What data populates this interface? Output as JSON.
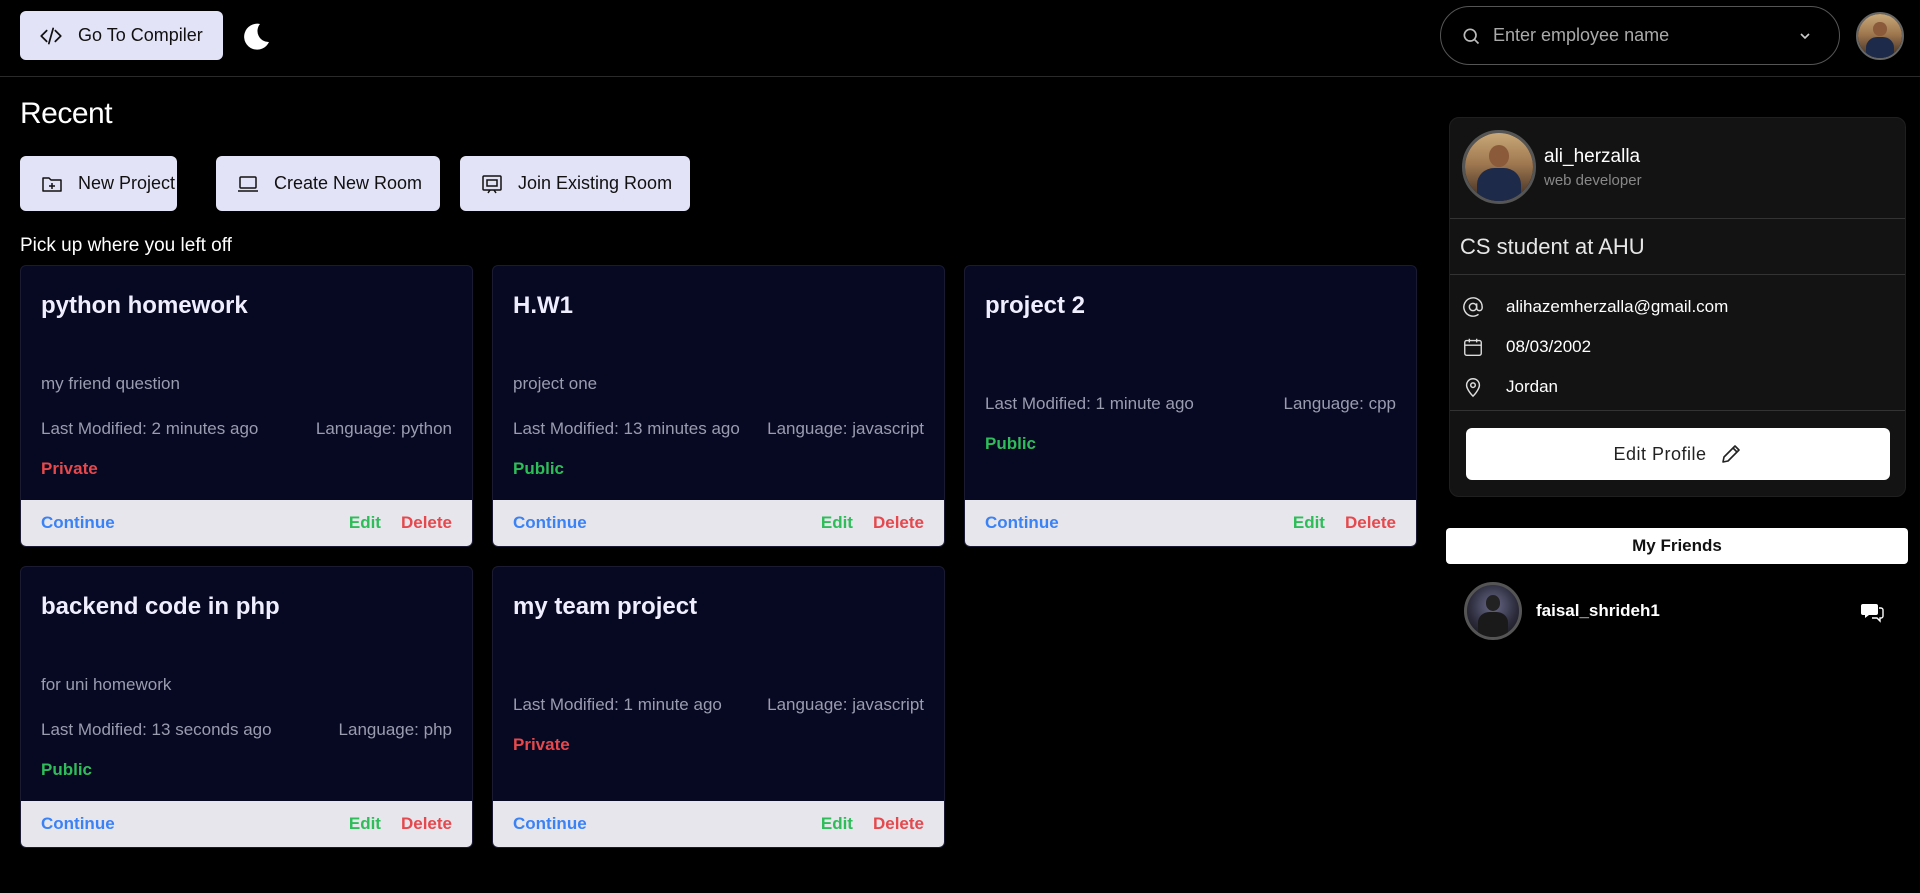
{
  "header": {
    "compiler_label": "Go To Compiler",
    "search_placeholder": "Enter employee name"
  },
  "main": {
    "title": "Recent",
    "actions": {
      "new_project": "New Project",
      "create_room": "Create New Room",
      "join_room": "Join Existing Room"
    },
    "subtitle": "Pick up where you left off",
    "projects": [
      {
        "title": "python homework",
        "description": "my friend question",
        "modified": "Last Modified: 2 minutes ago",
        "language": "Language: python",
        "visibility": "Private"
      },
      {
        "title": "H.W1",
        "description": "project one",
        "modified": "Last Modified: 13 minutes ago",
        "language": "Language: javascript",
        "visibility": "Public"
      },
      {
        "title": "project 2",
        "description": "",
        "modified": "Last Modified: 1 minute ago",
        "language": "Language: cpp",
        "visibility": "Public"
      },
      {
        "title": "backend code in php",
        "description": "for uni homework",
        "modified": "Last Modified: 13 seconds ago",
        "language": "Language: php",
        "visibility": "Public"
      },
      {
        "title": "my team project",
        "description": "",
        "modified": "Last Modified: 1 minute ago",
        "language": "Language: javascript",
        "visibility": "Private"
      }
    ],
    "card_actions": {
      "continue": "Continue",
      "edit": "Edit",
      "delete": "Delete"
    }
  },
  "profile": {
    "username": "ali_herzalla",
    "role": "web developer",
    "bio": "CS student at AHU",
    "email": "alihazemherzalla@gmail.com",
    "birthdate": "08/03/2002",
    "location": "Jordan",
    "edit_label": "Edit Profile"
  },
  "friends": {
    "title": "My Friends",
    "items": [
      {
        "name": "faisal_shrideh1"
      }
    ]
  },
  "colors": {
    "accent_button": "#e3e3f7",
    "card_bg": "#070821",
    "private": "#e5484d",
    "public": "#2ebd59",
    "continue": "#3b82f6"
  }
}
